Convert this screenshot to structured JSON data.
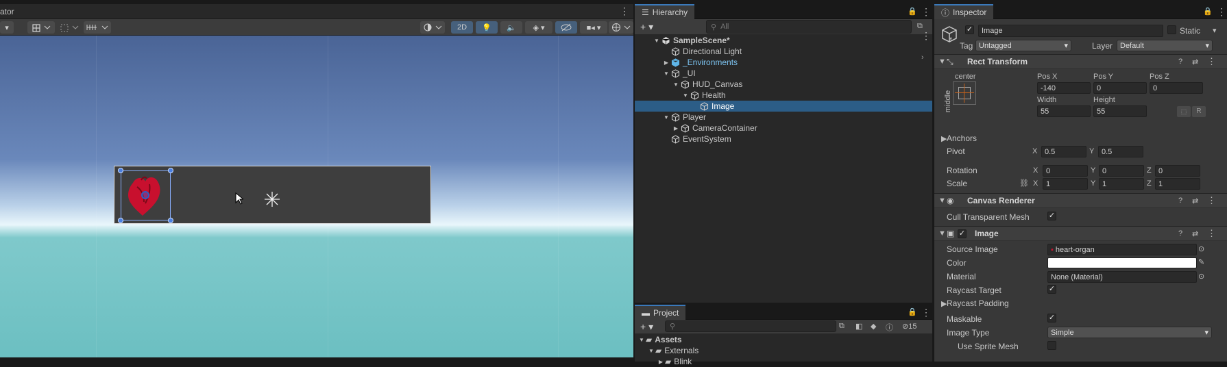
{
  "scene": {
    "tab_title": "ator",
    "menu_icon": "kebab-menu-icon",
    "toolbar": {
      "mode_2d": "2D"
    }
  },
  "hierarchy": {
    "tab_title": "Hierarchy",
    "search_placeholder": "All",
    "add_label": "+",
    "items": [
      {
        "label": "SampleScene*",
        "depth": 0,
        "expanded": true,
        "bold": true,
        "icon": "unity-scene-icon"
      },
      {
        "label": "Directional Light",
        "depth": 1,
        "expanded": null,
        "icon": "gameobject-cube-icon"
      },
      {
        "label": "_Environments",
        "depth": 1,
        "expanded": false,
        "icon": "prefab-cube-icon",
        "prefab": true
      },
      {
        "label": "_UI",
        "depth": 1,
        "expanded": true,
        "icon": "gameobject-cube-icon"
      },
      {
        "label": "HUD_Canvas",
        "depth": 2,
        "expanded": true,
        "icon": "gameobject-cube-icon"
      },
      {
        "label": "Health",
        "depth": 3,
        "expanded": true,
        "icon": "gameobject-cube-icon"
      },
      {
        "label": "Image",
        "depth": 4,
        "expanded": null,
        "icon": "gameobject-cube-icon",
        "selected": true
      },
      {
        "label": "Player",
        "depth": 1,
        "expanded": true,
        "icon": "gameobject-cube-icon"
      },
      {
        "label": "CameraContainer",
        "depth": 2,
        "expanded": false,
        "icon": "gameobject-cube-icon"
      },
      {
        "label": "EventSystem",
        "depth": 1,
        "expanded": null,
        "icon": "gameobject-cube-icon"
      }
    ]
  },
  "project": {
    "tab_title": "Project",
    "add_label": "+",
    "hidden_count": "15",
    "tree": [
      {
        "label": "Assets",
        "bold": true
      },
      {
        "label": "Externals",
        "bold": false
      },
      {
        "label": "Blink",
        "bold": false
      }
    ]
  },
  "inspector": {
    "tab_title": "Inspector",
    "object_name": "Image",
    "static_label": "Static",
    "tag_label": "Tag",
    "tag_value": "Untagged",
    "layer_label": "Layer",
    "layer_value": "Default",
    "rect_transform": {
      "title": "Rect Transform",
      "anchor_h": "center",
      "anchor_v": "middle",
      "pos_x_label": "Pos X",
      "pos_x": "-140",
      "pos_y_label": "Pos Y",
      "pos_y": "0",
      "pos_z_label": "Pos Z",
      "pos_z": "0",
      "width_label": "Width",
      "width": "55",
      "height_label": "Height",
      "height": "55",
      "r_label": "R",
      "anchors_label": "Anchors",
      "pivot_label": "Pivot",
      "pivot_x": "0.5",
      "pivot_y": "0.5",
      "rotation_label": "Rotation",
      "rot_x": "0",
      "rot_y": "0",
      "rot_z": "0",
      "scale_label": "Scale",
      "scale_x": "1",
      "scale_y": "1",
      "scale_z": "1",
      "x": "X",
      "y": "Y",
      "z": "Z"
    },
    "canvas_renderer": {
      "title": "Canvas Renderer",
      "cull_label": "Cull Transparent Mesh",
      "cull_checked": true
    },
    "image": {
      "title": "Image",
      "source_label": "Source Image",
      "source_value": "heart-organ",
      "color_label": "Color",
      "color_value": "#ffffff",
      "material_label": "Material",
      "material_value": "None (Material)",
      "raycast_label": "Raycast Target",
      "raycast_padding_label": "Raycast Padding",
      "maskable_label": "Maskable",
      "image_type_label": "Image Type",
      "image_type_value": "Simple",
      "use_sprite_mesh_label": "Use Sprite Mesh"
    }
  },
  "colors": {
    "selection": "#2c5d87",
    "accent": "#3a79bb",
    "heart": "#c8102e"
  }
}
